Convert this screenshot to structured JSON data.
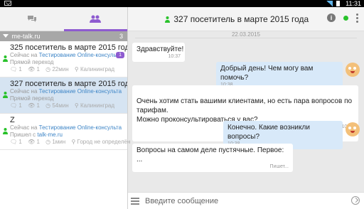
{
  "status": {
    "time": "11:31"
  },
  "tabs": [
    {
      "name": "chats",
      "icon": "chat-bubbles-icon"
    },
    {
      "name": "visitors",
      "icon": "users-icon",
      "active": true
    }
  ],
  "group": {
    "label": "me-talk.ru",
    "count": "3"
  },
  "visitors": [
    {
      "name": "325 посетитель в марте 2015 года",
      "now_prefix": "Сейчас на",
      "now_link": "Тестирование Online-консульта",
      "source": "Прямой переход",
      "msgs": "1",
      "views": "1",
      "duration": "22мин",
      "city": "Калининград",
      "badge": "1"
    },
    {
      "name": "327 посетитель в марте 2015 года",
      "now_prefix": "Сейчас на",
      "now_link": "Тестирование Online-консульта",
      "source": "Прямой переход",
      "msgs": "1",
      "views": "1",
      "duration": "54мин",
      "city": "Калининград"
    },
    {
      "name": "Z",
      "now_prefix": "Сейчас на",
      "now_link": "Тестирование Online-консульта",
      "source_prefix": "Пришел с",
      "source_link": "talk-me.ru",
      "msgs": "1",
      "views": "1",
      "duration": "1мин",
      "city": "Город не определён"
    }
  ],
  "header": {
    "title": "327 посетитель в марте 2015 года"
  },
  "chat": {
    "date": "22.03.2015",
    "messages": [
      {
        "dir": "in",
        "text": "Здравствуйте!",
        "time": "10:37"
      },
      {
        "dir": "out",
        "text": "Добрый день! Чем могу вам помочь?",
        "time": "10:38"
      },
      {
        "dir": "in",
        "text": "Очень хотим стать вашими клиентами, но есть пара вопросов по тарифам.\nМожно проконсультироваться у вас?",
        "time": "10:38"
      },
      {
        "dir": "out",
        "text": "Конечно. Какие возникли вопросы?",
        "time": "10:38"
      },
      {
        "dir": "in",
        "text": "Вопросы на самом деле пустячные. Первое: ...",
        "time": "Пишет..."
      }
    ]
  },
  "composer": {
    "placeholder": "Введите сообщение"
  },
  "colors": {
    "accent": "#8e5bd0",
    "online": "#29c22b",
    "outgoing": "#d8e9f9",
    "selected": "#d6e4f2"
  }
}
